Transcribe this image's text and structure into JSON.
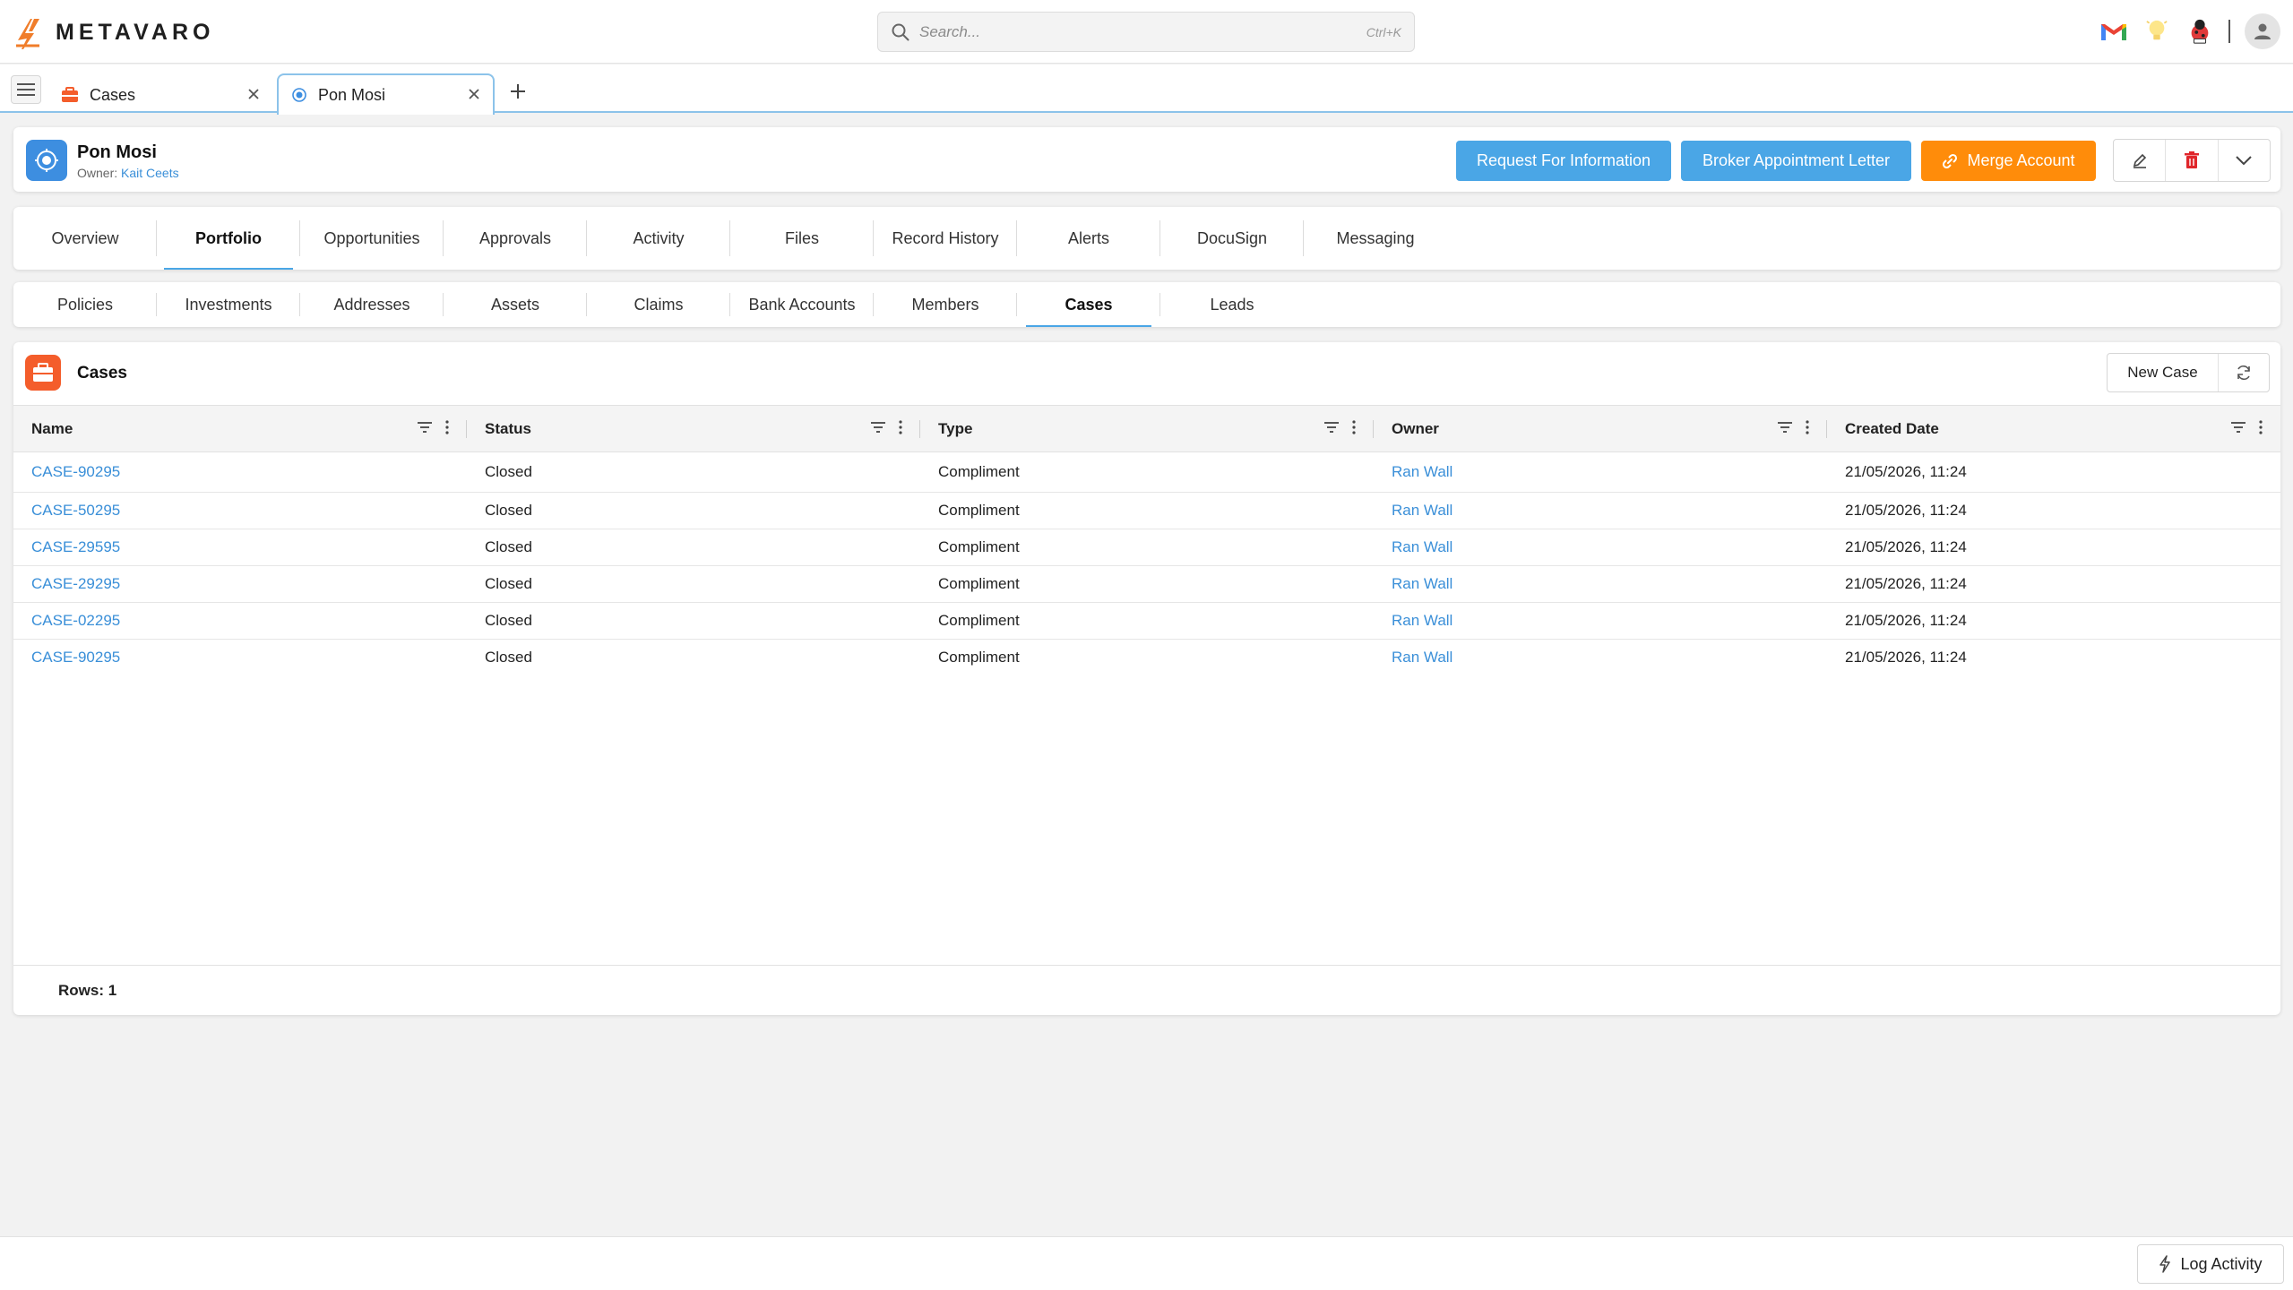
{
  "app": {
    "logo_text": "METAVARO"
  },
  "search": {
    "placeholder": "Search...",
    "shortcut": "Ctrl+K"
  },
  "tabs": [
    {
      "label": "Cases",
      "icon": "briefcase-icon"
    },
    {
      "label": "Pon Mosi",
      "icon": "target-icon",
      "active": true
    }
  ],
  "record": {
    "title": "Pon Mosi",
    "owner_label": "Owner:",
    "owner_name": "Kait Ceets",
    "buttons": {
      "request_info": "Request For Information",
      "broker_letter": "Broker Appointment Letter",
      "merge_account": "Merge Account"
    }
  },
  "main_tabs": [
    "Overview",
    "Portfolio",
    "Opportunities",
    "Approvals",
    "Activity",
    "Files",
    "Record History",
    "Alerts",
    "DocuSign",
    "Messaging"
  ],
  "main_tab_active": "Portfolio",
  "sub_tabs": [
    "Policies",
    "Investments",
    "Addresses",
    "Assets",
    "Claims",
    "Bank Accounts",
    "Members",
    "Cases",
    "Leads"
  ],
  "sub_tab_active": "Cases",
  "panel": {
    "title": "Cases",
    "new_button": "New Case",
    "columns": [
      "Name",
      "Status",
      "Type",
      "Owner",
      "Created Date"
    ],
    "rows": [
      {
        "name": "CASE-90295",
        "status": "Closed",
        "type": "Compliment",
        "owner": "Ran Wall",
        "created": "21/05/2026, 11:24"
      },
      {
        "name": "CASE-50295",
        "status": "Closed",
        "type": "Compliment",
        "owner": "Ran Wall",
        "created": "21/05/2026, 11:24"
      },
      {
        "name": "CASE-29595",
        "status": "Closed",
        "type": "Compliment",
        "owner": "Ran Wall",
        "created": "21/05/2026, 11:24"
      },
      {
        "name": "CASE-29295",
        "status": "Closed",
        "type": "Compliment",
        "owner": "Ran Wall",
        "created": "21/05/2026, 11:24"
      },
      {
        "name": "CASE-02295",
        "status": "Closed",
        "type": "Compliment",
        "owner": "Ran Wall",
        "created": "21/05/2026, 11:24"
      },
      {
        "name": "CASE-90295",
        "status": "Closed",
        "type": "Compliment",
        "owner": "Ran Wall",
        "created": "21/05/2026, 11:24"
      }
    ],
    "rows_label": "Rows: 1"
  },
  "bottom": {
    "log_activity": "Log Activity"
  },
  "colors": {
    "accent_blue": "#4aa6e6",
    "accent_orange": "#ff8c0a",
    "link_blue": "#3a8fd8",
    "cases_icon_bg": "#f45d2b"
  }
}
